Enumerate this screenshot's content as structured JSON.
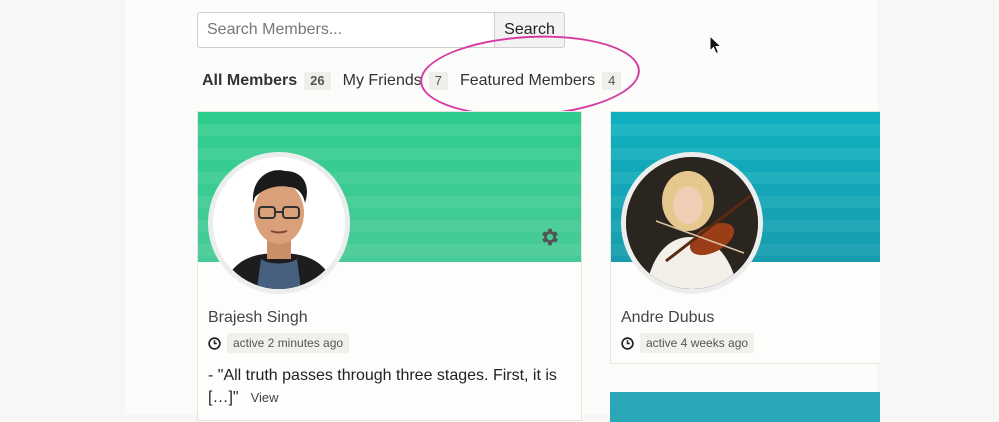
{
  "search": {
    "placeholder": "Search Members...",
    "button_label": "Search"
  },
  "tabs": [
    {
      "label": "All Members",
      "count": "26"
    },
    {
      "label": "My Friends",
      "count": "7"
    },
    {
      "label": "Featured Members",
      "count": "4"
    }
  ],
  "members": [
    {
      "name": "Brajesh Singh",
      "last_active": "active 2 minutes ago",
      "excerpt": "- \"All truth passes through three stages. First, it is […]\"",
      "view_label": "View"
    },
    {
      "name": "Andre Dubus",
      "last_active": "active 4 weeks ago"
    }
  ],
  "colors": {
    "highlight_ellipse": "#d63ba3",
    "cover_green": "#2ecc8e",
    "cover_teal": "#0fb0c0"
  },
  "icons": [
    "gear-icon",
    "clock-icon",
    "mouse-cursor-icon"
  ]
}
